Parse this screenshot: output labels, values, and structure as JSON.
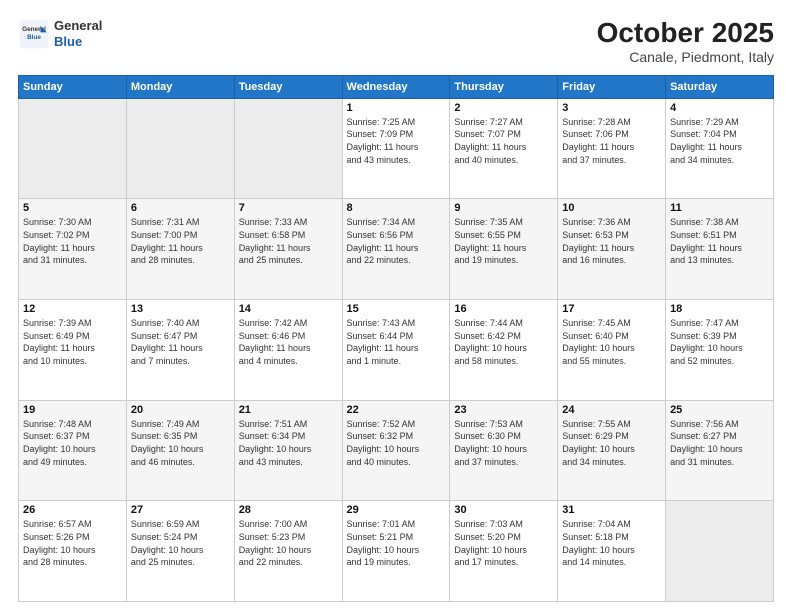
{
  "header": {
    "logo_general": "General",
    "logo_blue": "Blue",
    "month_year": "October 2025",
    "location": "Canale, Piedmont, Italy"
  },
  "weekdays": [
    "Sunday",
    "Monday",
    "Tuesday",
    "Wednesday",
    "Thursday",
    "Friday",
    "Saturday"
  ],
  "weeks": [
    [
      {
        "day": "",
        "info": ""
      },
      {
        "day": "",
        "info": ""
      },
      {
        "day": "",
        "info": ""
      },
      {
        "day": "1",
        "info": "Sunrise: 7:25 AM\nSunset: 7:09 PM\nDaylight: 11 hours\nand 43 minutes."
      },
      {
        "day": "2",
        "info": "Sunrise: 7:27 AM\nSunset: 7:07 PM\nDaylight: 11 hours\nand 40 minutes."
      },
      {
        "day": "3",
        "info": "Sunrise: 7:28 AM\nSunset: 7:06 PM\nDaylight: 11 hours\nand 37 minutes."
      },
      {
        "day": "4",
        "info": "Sunrise: 7:29 AM\nSunset: 7:04 PM\nDaylight: 11 hours\nand 34 minutes."
      }
    ],
    [
      {
        "day": "5",
        "info": "Sunrise: 7:30 AM\nSunset: 7:02 PM\nDaylight: 11 hours\nand 31 minutes."
      },
      {
        "day": "6",
        "info": "Sunrise: 7:31 AM\nSunset: 7:00 PM\nDaylight: 11 hours\nand 28 minutes."
      },
      {
        "day": "7",
        "info": "Sunrise: 7:33 AM\nSunset: 6:58 PM\nDaylight: 11 hours\nand 25 minutes."
      },
      {
        "day": "8",
        "info": "Sunrise: 7:34 AM\nSunset: 6:56 PM\nDaylight: 11 hours\nand 22 minutes."
      },
      {
        "day": "9",
        "info": "Sunrise: 7:35 AM\nSunset: 6:55 PM\nDaylight: 11 hours\nand 19 minutes."
      },
      {
        "day": "10",
        "info": "Sunrise: 7:36 AM\nSunset: 6:53 PM\nDaylight: 11 hours\nand 16 minutes."
      },
      {
        "day": "11",
        "info": "Sunrise: 7:38 AM\nSunset: 6:51 PM\nDaylight: 11 hours\nand 13 minutes."
      }
    ],
    [
      {
        "day": "12",
        "info": "Sunrise: 7:39 AM\nSunset: 6:49 PM\nDaylight: 11 hours\nand 10 minutes."
      },
      {
        "day": "13",
        "info": "Sunrise: 7:40 AM\nSunset: 6:47 PM\nDaylight: 11 hours\nand 7 minutes."
      },
      {
        "day": "14",
        "info": "Sunrise: 7:42 AM\nSunset: 6:46 PM\nDaylight: 11 hours\nand 4 minutes."
      },
      {
        "day": "15",
        "info": "Sunrise: 7:43 AM\nSunset: 6:44 PM\nDaylight: 11 hours\nand 1 minute."
      },
      {
        "day": "16",
        "info": "Sunrise: 7:44 AM\nSunset: 6:42 PM\nDaylight: 10 hours\nand 58 minutes."
      },
      {
        "day": "17",
        "info": "Sunrise: 7:45 AM\nSunset: 6:40 PM\nDaylight: 10 hours\nand 55 minutes."
      },
      {
        "day": "18",
        "info": "Sunrise: 7:47 AM\nSunset: 6:39 PM\nDaylight: 10 hours\nand 52 minutes."
      }
    ],
    [
      {
        "day": "19",
        "info": "Sunrise: 7:48 AM\nSunset: 6:37 PM\nDaylight: 10 hours\nand 49 minutes."
      },
      {
        "day": "20",
        "info": "Sunrise: 7:49 AM\nSunset: 6:35 PM\nDaylight: 10 hours\nand 46 minutes."
      },
      {
        "day": "21",
        "info": "Sunrise: 7:51 AM\nSunset: 6:34 PM\nDaylight: 10 hours\nand 43 minutes."
      },
      {
        "day": "22",
        "info": "Sunrise: 7:52 AM\nSunset: 6:32 PM\nDaylight: 10 hours\nand 40 minutes."
      },
      {
        "day": "23",
        "info": "Sunrise: 7:53 AM\nSunset: 6:30 PM\nDaylight: 10 hours\nand 37 minutes."
      },
      {
        "day": "24",
        "info": "Sunrise: 7:55 AM\nSunset: 6:29 PM\nDaylight: 10 hours\nand 34 minutes."
      },
      {
        "day": "25",
        "info": "Sunrise: 7:56 AM\nSunset: 6:27 PM\nDaylight: 10 hours\nand 31 minutes."
      }
    ],
    [
      {
        "day": "26",
        "info": "Sunrise: 6:57 AM\nSunset: 5:26 PM\nDaylight: 10 hours\nand 28 minutes."
      },
      {
        "day": "27",
        "info": "Sunrise: 6:59 AM\nSunset: 5:24 PM\nDaylight: 10 hours\nand 25 minutes."
      },
      {
        "day": "28",
        "info": "Sunrise: 7:00 AM\nSunset: 5:23 PM\nDaylight: 10 hours\nand 22 minutes."
      },
      {
        "day": "29",
        "info": "Sunrise: 7:01 AM\nSunset: 5:21 PM\nDaylight: 10 hours\nand 19 minutes."
      },
      {
        "day": "30",
        "info": "Sunrise: 7:03 AM\nSunset: 5:20 PM\nDaylight: 10 hours\nand 17 minutes."
      },
      {
        "day": "31",
        "info": "Sunrise: 7:04 AM\nSunset: 5:18 PM\nDaylight: 10 hours\nand 14 minutes."
      },
      {
        "day": "",
        "info": ""
      }
    ]
  ]
}
